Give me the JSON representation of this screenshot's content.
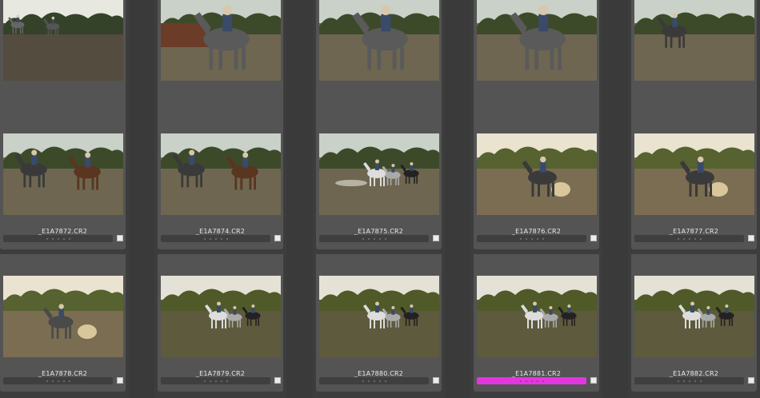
{
  "colors": {
    "background": "#3a3a3a",
    "cell": "#545454",
    "magenta_label": "#e436e0"
  },
  "rows": [
    {
      "cells": [
        {
          "filename": "",
          "scene": "dusk-field-riders"
        },
        {
          "filename": "",
          "scene": "horse-closeup-trailer"
        },
        {
          "filename": "",
          "scene": "horse-closeup-field"
        },
        {
          "filename": "",
          "scene": "horse-closeup-field"
        },
        {
          "filename": "",
          "scene": "rider-field-right"
        }
      ]
    },
    {
      "cells": [
        {
          "filename": "_E1A7872.CR2",
          "rating_dots": 5,
          "label": "none",
          "scene": "two-riders-field"
        },
        {
          "filename": "_E1A7874.CR2",
          "rating_dots": 5,
          "label": "none",
          "scene": "two-riders-field"
        },
        {
          "filename": "_E1A7875.CR2",
          "rating_dots": 5,
          "label": "none",
          "scene": "rider-field-dusty"
        },
        {
          "filename": "_E1A7876.CR2",
          "rating_dots": 5,
          "label": "none",
          "scene": "rider-sunset-dust"
        },
        {
          "filename": "_E1A7877.CR2",
          "rating_dots": 5,
          "label": "none",
          "scene": "rider-sunset-dust"
        }
      ]
    },
    {
      "cells": [
        {
          "filename": "_E1A7878.CR2",
          "rating_dots": 5,
          "label": "none",
          "scene": "rider-sunset-small"
        },
        {
          "filename": "_E1A7879.CR2",
          "rating_dots": 5,
          "label": "none",
          "scene": "group-riders-trees"
        },
        {
          "filename": "_E1A7880.CR2",
          "rating_dots": 5,
          "label": "none",
          "scene": "group-riders-trees"
        },
        {
          "filename": "_E1A7881.CR2",
          "rating_dots": 5,
          "label": "magenta",
          "scene": "group-riders-trees"
        },
        {
          "filename": "_E1A7882.CR2",
          "rating_dots": 5,
          "label": "none",
          "scene": "group-riders-trees"
        }
      ]
    }
  ]
}
